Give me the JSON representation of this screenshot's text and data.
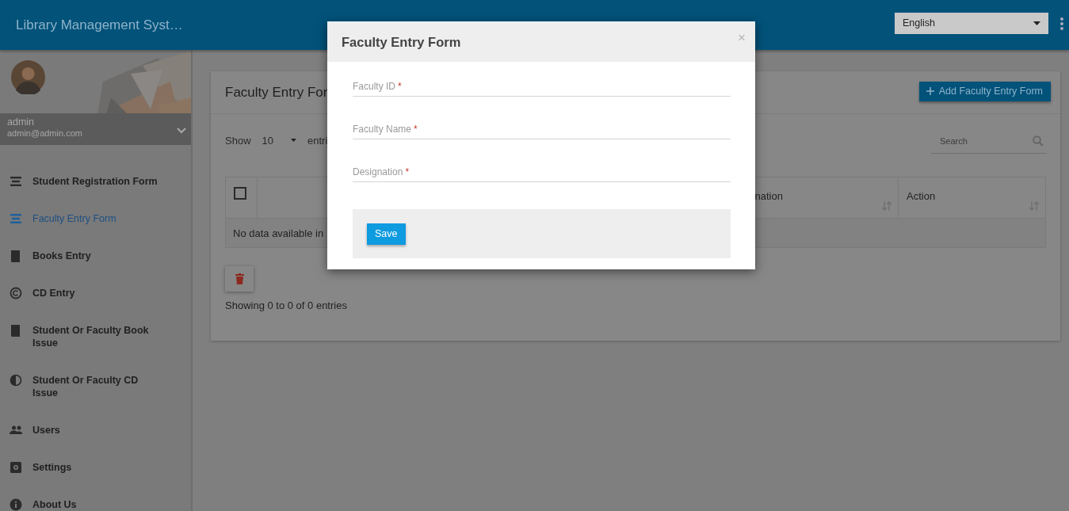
{
  "app": {
    "title": "Library Management Syst…"
  },
  "language_select": {
    "value": "English"
  },
  "profile": {
    "name": "admin",
    "email": "admin@admin.com"
  },
  "sidebar": {
    "items": [
      {
        "label": "Student Registration Form",
        "kind": "list",
        "selected": false
      },
      {
        "label": "Faculty Entry Form",
        "kind": "list",
        "selected": true
      },
      {
        "label": "Books Entry",
        "kind": "book",
        "selected": false
      },
      {
        "label": "CD Entry",
        "kind": "copyright",
        "selected": false
      },
      {
        "label": "Student Or Faculty Book Issue",
        "kind": "book",
        "selected": false
      },
      {
        "label": "Student Or Faculty CD Issue",
        "kind": "contrast",
        "selected": false
      },
      {
        "label": "Users",
        "kind": "users",
        "selected": false
      },
      {
        "label": "Settings",
        "kind": "gear",
        "selected": false
      },
      {
        "label": "About Us",
        "kind": "info",
        "selected": false
      }
    ]
  },
  "card": {
    "title": "Faculty Entry For",
    "add_button": "Add Faculty Entry Form",
    "show_label": "Show",
    "page_length": "10",
    "entries_label": "entri",
    "search": {
      "placeholder": "Search"
    },
    "table": {
      "select_all": {
        "checked": false
      },
      "columns": [
        {
          "label": "nation"
        },
        {
          "label": "Action"
        }
      ],
      "empty_message": "No data available in"
    },
    "info": "Showing 0 to 0 of 0 entries"
  },
  "modal": {
    "title": "Faculty Entry Form",
    "close": "×",
    "fields": [
      {
        "label": "Faculty ID",
        "required_mark": "*"
      },
      {
        "label": "Faculty Name",
        "required_mark": "*"
      },
      {
        "label": "Designation",
        "required_mark": "*"
      }
    ],
    "save_button": "Save"
  }
}
